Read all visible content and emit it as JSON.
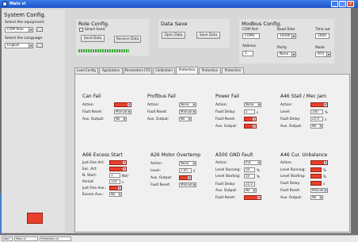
{
  "window": {
    "title": "Main vi"
  },
  "system_config": {
    "title": "System Config.",
    "equipment_label": "Select the equipment",
    "equipment_value": "COM Role",
    "language_label": "Select the Language",
    "language_value": "English"
  },
  "role_config": {
    "title": "Role Config.",
    "smart_send_label": "Smart Send",
    "send_label": "Send Data",
    "receive_label": "Receive Data"
  },
  "data_save": {
    "title": "Data Save",
    "open_label": "Open Data",
    "save_label": "Save Data"
  },
  "modbus_config": {
    "title": "Modbus Config.",
    "com_port_label": "COM Port",
    "com_port_value": "COM1",
    "baud_rate_label": "Baud Rate",
    "baud_rate_value": "19200",
    "time_out_label": "Time out",
    "time_out_value": "1000",
    "address_label": "Address",
    "address_value": "1",
    "parity_label": "Parity",
    "parity_value": "None",
    "mode_label": "Mode",
    "mode_value": "RTU"
  },
  "tabs": [
    "Load Config",
    "Application",
    "Parameters CFG",
    "Calibration",
    "Protection",
    "Protection",
    "Protection"
  ],
  "blocks": {
    "can_fail": {
      "title": "Can Fail",
      "action": "Action:",
      "fault_reset": "Fault Reset:",
      "fault_reset_value": "Manual",
      "aux_output": "Aux. Output:",
      "aux_value": "No"
    },
    "profibus_fail": {
      "title": "Profibus Fail",
      "action": "Action:",
      "action_value": "None",
      "fault_reset": "Fault Reset:",
      "fault_reset_value": "Manual",
      "aux_output": "Aux. Output:",
      "aux_value": "No"
    },
    "power_fail": {
      "title": "Power Fail",
      "action": "Action:",
      "action_value": "None",
      "fault_delay": "Fault Delay:",
      "fault_delay_value": "5",
      "fault_delay_unit": "s",
      "fault_reset": "Fault Reset:",
      "aux_output": "Aux. Output:"
    },
    "a46_stall": {
      "title": "A46 Stall / Mec Jam",
      "action": "Action:",
      "level": "Level:",
      "level_value": "100",
      "level_unit": "%",
      "fault_delay": "Fault Delay:",
      "fault_delay_value": "25.0",
      "fault_delay_unit": "s",
      "aux_output": "Aux. Output:",
      "aux_value": "No"
    },
    "a66_excess": {
      "title": "A66 Excess Start",
      "just_one_act": "Just One Act:",
      "exc_act": "Exc. Act:",
      "n_start": "N. Start:",
      "n_start_value": "1",
      "n_start_unit": "Nstr",
      "period": "Period:",
      "period_value": "120",
      "period_unit": "s",
      "just_one_aux": "Just One Aux.:",
      "excess_aux": "Excess Aux.:",
      "excess_aux_value": "No"
    },
    "a26_motor": {
      "title": "A26 Motor Overtemp",
      "action": "Action:",
      "action_value": "None",
      "level": "Level:",
      "level_value": "1.05",
      "level_unit": "C",
      "aux_output": "Aux. Output:",
      "fault_reset": "Fault Reset:",
      "fault_reset_value": "Manual"
    },
    "a500_gnd": {
      "title": "A500 GND Fault",
      "action": "Action:",
      "action_value": "Init",
      "level_running": "Level Running:",
      "level_running_value": "50",
      "level_running_unit": "%",
      "level_starting": "Level Starting:",
      "level_starting_value": "50",
      "level_starting_unit": "%",
      "fault_delay": "Fault Delay:",
      "fault_delay_value": "25.0",
      "aux_output": "Aux. Output:",
      "aux_value": "No",
      "fault_reset": "Fault Reset:"
    },
    "a46_unbalance": {
      "title": "A46 Cur. Unbalance",
      "action": "Action:",
      "level_running": "Level Running:",
      "level_running_unit": "%",
      "level_starting": "Level Starting:",
      "level_starting_unit": "%",
      "fault_delay": "Fault Delay:",
      "fault_delay_unit": "s",
      "fault_reset": "Fault Reset:",
      "fault_reset_value": "Manual",
      "aux_output": "Aux. Output:",
      "aux_value": "No"
    }
  },
  "taskbar": [
    "start",
    "Main.vi",
    "Protection.vi"
  ]
}
